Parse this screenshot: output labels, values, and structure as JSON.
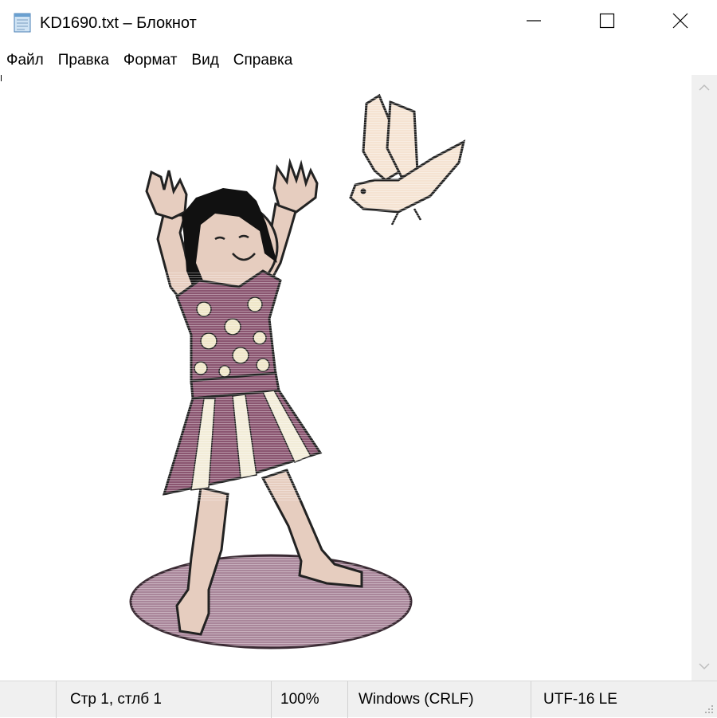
{
  "window": {
    "title": "KD1690.txt – Блокнот",
    "icons": {
      "app": "notepad-icon",
      "minimize": "minimize-icon",
      "maximize": "maximize-icon",
      "close": "close-icon"
    }
  },
  "menu": {
    "items": [
      {
        "label": "Файл"
      },
      {
        "label": "Правка"
      },
      {
        "label": "Формат"
      },
      {
        "label": "Вид"
      },
      {
        "label": "Справка"
      }
    ]
  },
  "editor": {
    "content": "ASCII-art picture: a girl in a flowered dress raising her arms toward a flying dove",
    "colors": {
      "dress": "#8a5570",
      "skin": "#e6cdbf",
      "hair": "#111111",
      "skirt_light": "#f2ecd8",
      "shadow": "#a9869a",
      "bird": "#f5e3d2"
    }
  },
  "statusbar": {
    "position": "Стр 1, стлб 1",
    "zoom": "100%",
    "line_endings": "Windows (CRLF)",
    "encoding": "UTF-16 LE"
  },
  "scrollbar": {
    "up_icon": "chevron-up-icon",
    "down_icon": "chevron-down-icon"
  }
}
